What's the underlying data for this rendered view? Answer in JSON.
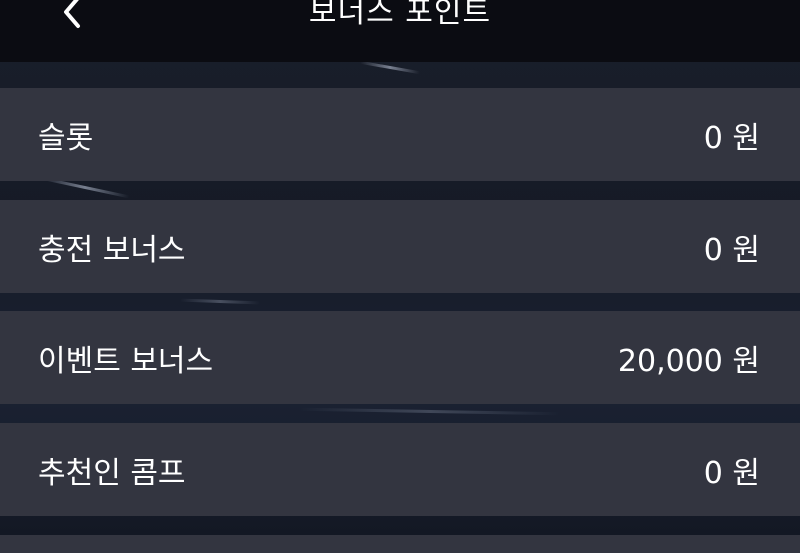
{
  "header": {
    "title": "보너스 포인트",
    "back_icon": "chevron-left-icon"
  },
  "colors": {
    "header_bg": "#0b0c12",
    "row_bg": "#333540",
    "text": "#ffffff"
  },
  "items": [
    {
      "label": "슬롯",
      "value": "0 원"
    },
    {
      "label": "충전 보너스",
      "value": "0 원"
    },
    {
      "label": "이벤트 보너스",
      "value": "20,000 원"
    },
    {
      "label": "추천인 콤프",
      "value": "0 원"
    }
  ]
}
